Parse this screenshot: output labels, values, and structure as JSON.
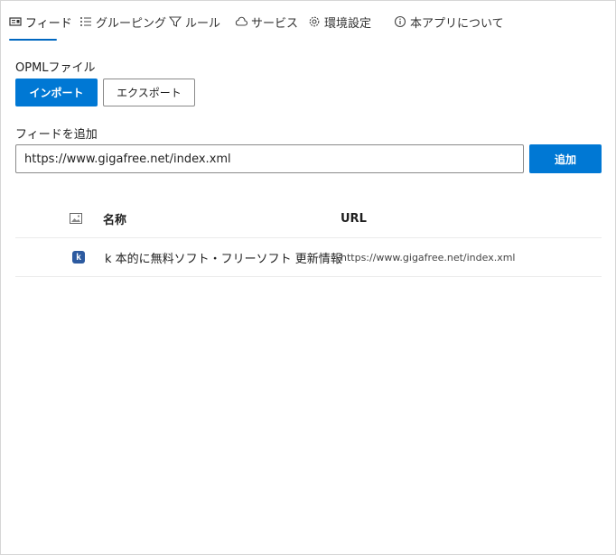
{
  "tabs": [
    {
      "label": "フィード",
      "icon": "feed-icon",
      "active": true
    },
    {
      "label": "グルーピング",
      "icon": "grouping-list-icon"
    },
    {
      "label": "ルール",
      "icon": "filter-icon"
    },
    {
      "label": "サービス",
      "icon": "cloud-icon"
    },
    {
      "label": "環境設定",
      "icon": "gear-icon"
    },
    {
      "label": "本アプリについて",
      "icon": "info-icon"
    }
  ],
  "opml": {
    "label": "OPMLファイル",
    "import_label": "インポート",
    "export_label": "エクスポート"
  },
  "add_feed": {
    "label": "フィードを追加",
    "input_value": "https://www.gigafree.net/index.xml",
    "add_label": "追加"
  },
  "table": {
    "icon_column": "image-icon",
    "headers": {
      "name": "名称",
      "url": "URL"
    },
    "rows": [
      {
        "icon": "k",
        "name": "k 本的に無料ソフト・フリーソフト 更新情報",
        "url": "https://www.gigafree.net/index.xml"
      }
    ]
  },
  "colors": {
    "accent": "#0078d4",
    "border": "#8a8a8a"
  }
}
